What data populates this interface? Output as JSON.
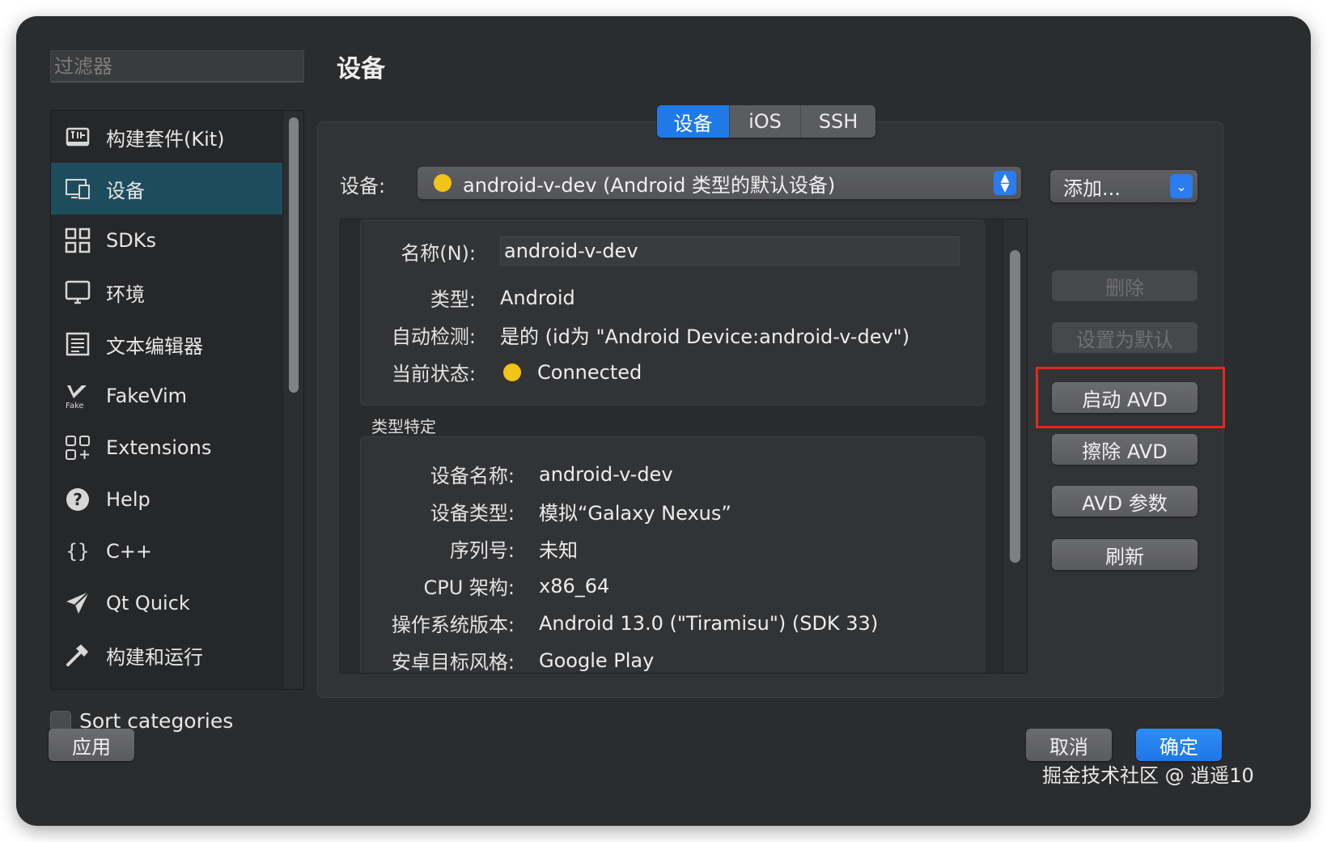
{
  "filter": {
    "placeholder": "过滤器"
  },
  "sidebar": {
    "items": [
      {
        "label": "构建套件(Kit)",
        "icon": "kit-icon"
      },
      {
        "label": "设备",
        "icon": "device-icon",
        "selected": true
      },
      {
        "label": "SDKs",
        "icon": "grid-icon"
      },
      {
        "label": "环境",
        "icon": "monitor-icon"
      },
      {
        "label": "文本编辑器",
        "icon": "text-editor-icon"
      },
      {
        "label": "FakeVim",
        "icon": "fakevim-icon"
      },
      {
        "label": "Extensions",
        "icon": "extensions-icon"
      },
      {
        "label": "Help",
        "icon": "help-icon"
      },
      {
        "label": "C++",
        "icon": "braces-icon"
      },
      {
        "label": "Qt Quick",
        "icon": "paper-plane-icon"
      },
      {
        "label": "构建和运行",
        "icon": "hammer-icon"
      }
    ],
    "sort_label": "Sort categories",
    "apply_label": "应用"
  },
  "page": {
    "title": "设备"
  },
  "tabs": [
    {
      "label": "设备",
      "active": true
    },
    {
      "label": "iOS",
      "active": false
    },
    {
      "label": "SSH",
      "active": false
    }
  ],
  "device_selector": {
    "label": "设备:",
    "value": "android-v-dev (Android 类型的默认设备)",
    "status_color": "#f2c318"
  },
  "add_button": {
    "label": "添加..."
  },
  "general": {
    "name_label": "名称(N):",
    "name_value": "android-v-dev",
    "type_label": "类型:",
    "type_value": "Android",
    "autodetect_label": "自动检测:",
    "autodetect_value": "是的 (id为 \"Android Device:android-v-dev\")",
    "state_label": "当前状态:",
    "state_value": "Connected"
  },
  "type_specific": {
    "title": "类型特定",
    "rows": [
      {
        "label": "设备名称:",
        "value": "android-v-dev"
      },
      {
        "label": "设备类型:",
        "value": "模拟“Galaxy Nexus”"
      },
      {
        "label": "序列号:",
        "value": "未知"
      },
      {
        "label": "CPU 架构:",
        "value": "x86_64"
      },
      {
        "label": "操作系统版本:",
        "value": "Android 13.0 (\"Tiramisu\") (SDK 33)"
      },
      {
        "label": "安卓目标风格:",
        "value": "Google Play"
      }
    ]
  },
  "actions": {
    "delete": "删除",
    "set_default": "设置为默认",
    "start_avd": "启动 AVD",
    "erase_avd": "擦除 AVD",
    "avd_params": "AVD 参数",
    "refresh": "刷新"
  },
  "footer": {
    "cancel": "取消",
    "ok": "确定"
  },
  "watermark": "掘金技术社区 @ 逍遥10",
  "colors": {
    "accent": "#1f7ae8",
    "selection": "#1d4d5c",
    "highlight_box": "#e5271f"
  }
}
